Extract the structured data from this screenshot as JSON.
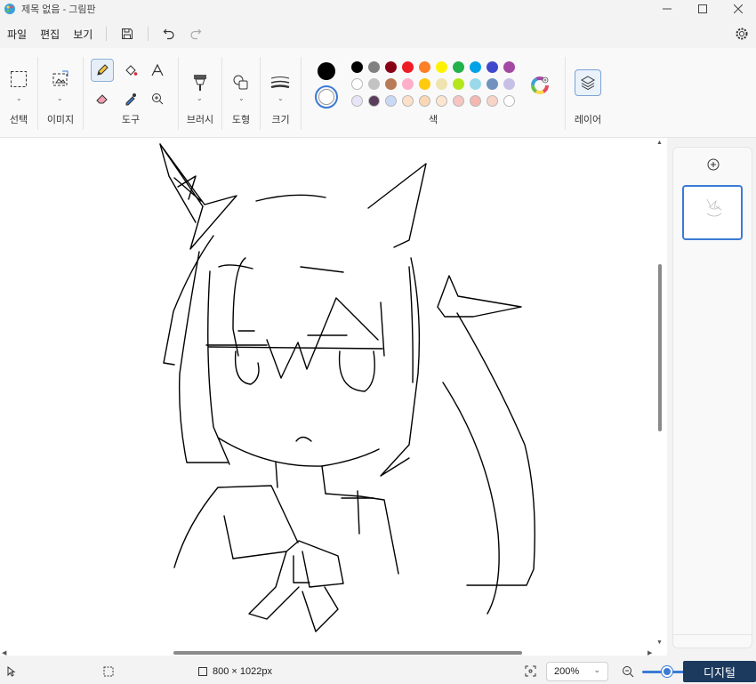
{
  "window": {
    "title": "제목 없음 - 그림판"
  },
  "menu": {
    "file": "파일",
    "edit": "편집",
    "view": "보기"
  },
  "ribbon": {
    "groups": {
      "select": "선택",
      "image": "이미지",
      "tools": "도구",
      "brushes": "브러시",
      "shapes": "도형",
      "size": "크기",
      "colors": "색",
      "layers": "레이어"
    },
    "primary_color": "#000000",
    "secondary_color": "#ffffff",
    "palette": [
      [
        "#000000",
        "#808080",
        "#880015",
        "#ed1c24",
        "#ff7f27",
        "#fff200",
        "#22b14c",
        "#00a2e8",
        "#3f48cc",
        "#a349a4"
      ],
      [
        "#ffffff",
        "#c3c3c3",
        "#b97a57",
        "#ffaec9",
        "#ffc90e",
        "#efe4b0",
        "#b5e61d",
        "#99d9ea",
        "#7092be",
        "#c8bfe7"
      ],
      [
        "#e8e4f8",
        "#5a3d5c",
        "#c9d8f7",
        "#fde0c8",
        "#fbd7b5",
        "#fde5d0",
        "#f6c4c1",
        "#f4b7b1",
        "#f8d4c6",
        "#ffffff"
      ]
    ]
  },
  "status": {
    "canvas_size": "800 × 1022px",
    "zoom": "200%",
    "watermark": "디지털"
  }
}
